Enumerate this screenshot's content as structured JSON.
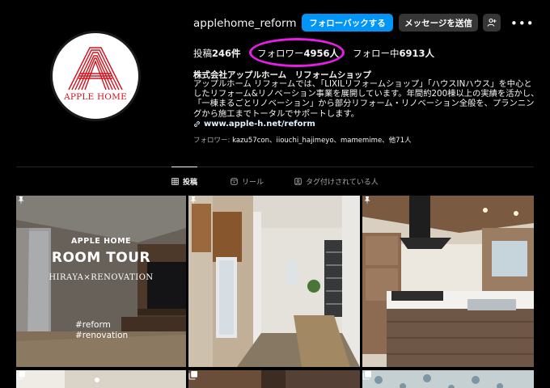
{
  "profile": {
    "username": "applehome_reform",
    "avatar_brand": "APPLE HOME",
    "buttons": {
      "follow_back": "フォローバックする",
      "message": "メッセージを送信"
    },
    "stats": {
      "posts_label": "投稿",
      "posts_value": "246件",
      "followers_label": "フォロワー",
      "followers_value": "4956人",
      "following_label": "フォロー中",
      "following_value": "6913人"
    },
    "bio": {
      "name": "株式会社アップルホーム　リフォームショップ",
      "text": "アップルホーム リフォームでは、「LIXILリフォームショップ」「ハウスINハウス」を中心としたリフォーム&リノベーション事業を展開しています。年間約200棟以上の実績を活かし、「一棟まるごとリノベーション」から部分リフォーム・リノベーション全般を、プランニングから施工までトータルでサポートします。",
      "link": "www.apple-h.net/reform"
    },
    "followed_by": {
      "label": "フォロワー: ",
      "names": "kazu57con、iiouchi_hajimeyo、mamemime、他71人"
    }
  },
  "tabs": [
    {
      "label": "投稿",
      "active": true
    },
    {
      "label": "リール",
      "active": false
    },
    {
      "label": "タグ付けされている人",
      "active": false
    }
  ],
  "grid": {
    "tile1": {
      "brand": "APPLE HOME",
      "title": "ROOM TOUR",
      "subtitle": "HIRAYA×RENOVATION",
      "tag1": "#reform",
      "tag2": "#renovation"
    }
  },
  "colors": {
    "accent": "#0095f6",
    "highlight": "#e81ee8",
    "brand_red": "#d4101b"
  }
}
